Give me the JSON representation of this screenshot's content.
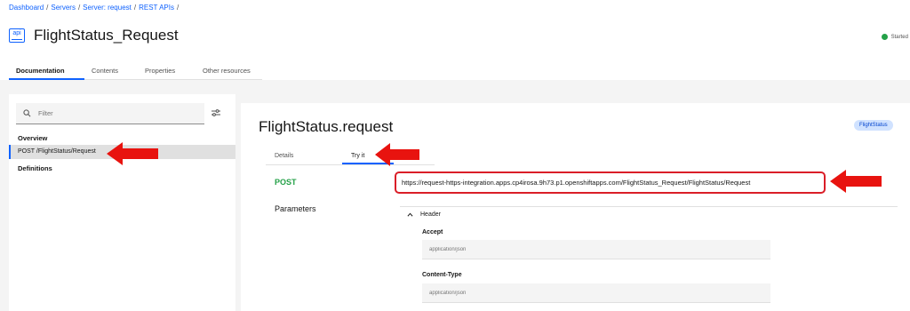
{
  "breadcrumb": [
    "Dashboard",
    "Servers",
    "Server: request",
    "REST APIs"
  ],
  "breadcrumb_sep": "/",
  "app_icon_text": "api",
  "page_title": "FlightStatus_Request",
  "status_text": "Started",
  "tabs": [
    "Documentation",
    "Contents",
    "Properties",
    "Other resources"
  ],
  "sidebar": {
    "filter_placeholder": "Filter",
    "overview": "Overview",
    "post_item": "POST /FlightStatus/Request",
    "definitions": "Definitions"
  },
  "main": {
    "title": "FlightStatus.request",
    "tag": "FlightStatus",
    "sub_tabs": [
      "Details",
      "Try it"
    ],
    "method": "POST",
    "url": "https://request-https-integration.apps.cp4irosa.9h73.p1.openshiftapps.com/FlightStatus_Request/FlightStatus/Request",
    "parameters_label": "Parameters",
    "header_label": "Header",
    "accept_label": "Accept",
    "accept_value": "application/json",
    "content_type_label": "Content-Type",
    "content_type_value": "application/json"
  },
  "colors": {
    "accent": "#0f62fe",
    "status_green": "#24a148",
    "annotation_red": "#e8130f"
  }
}
